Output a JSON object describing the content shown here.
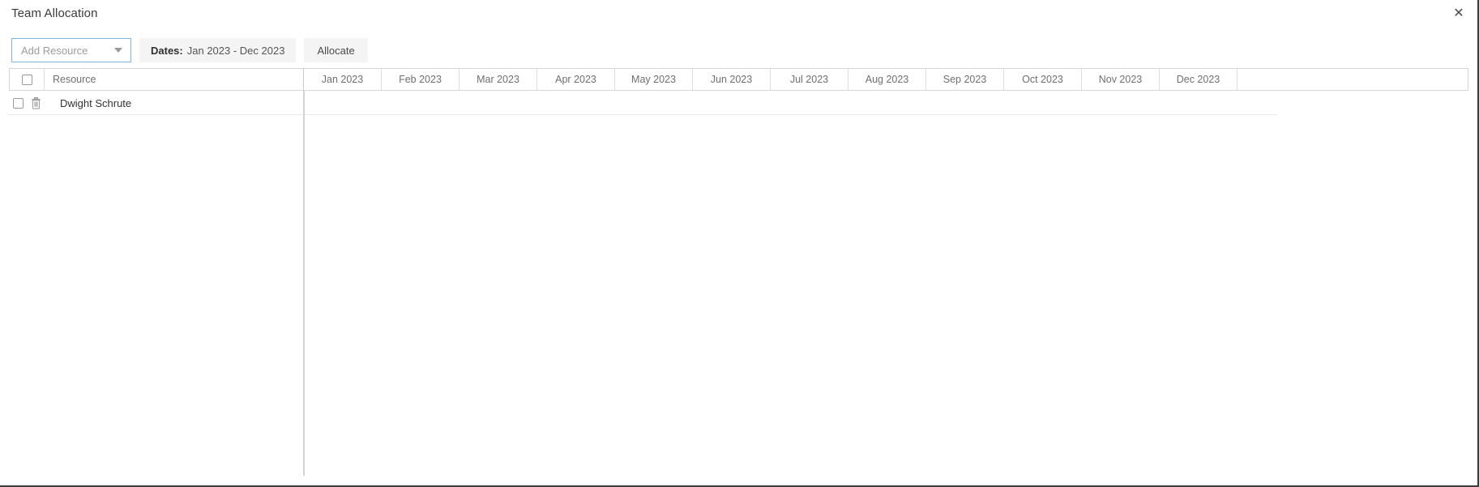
{
  "dialog": {
    "title": "Team Allocation",
    "close_icon": "close-icon",
    "close_label": "✕"
  },
  "toolbar": {
    "resource_select": {
      "placeholder": "Add Resource",
      "value": "",
      "caret_icon": "chevron-down-icon"
    },
    "dates_chip": {
      "label": "Dates:",
      "value": "Jan 2023 - Dec 2023"
    },
    "allocate_button": "Allocate"
  },
  "grid": {
    "columns": {
      "select_all_header": "",
      "resource_header": "Resource",
      "months": [
        "Jan 2023",
        "Feb 2023",
        "Mar 2023",
        "Apr 2023",
        "May 2023",
        "Jun 2023",
        "Jul 2023",
        "Aug 2023",
        "Sep 2023",
        "Oct 2023",
        "Nov 2023",
        "Dec 2023"
      ]
    },
    "rows": [
      {
        "name": "Dwight Schrute",
        "selected": false,
        "delete_icon": "trash-icon",
        "allocations": [
          "",
          "",
          "",
          "",
          "",
          "",
          "",
          "",
          "",
          "",
          "",
          ""
        ]
      }
    ]
  },
  "colors": {
    "accent": "#7eb6e0",
    "chip_background": "#f4f4f4",
    "border": "#d6d6d6",
    "text": "#3b3b3b"
  }
}
